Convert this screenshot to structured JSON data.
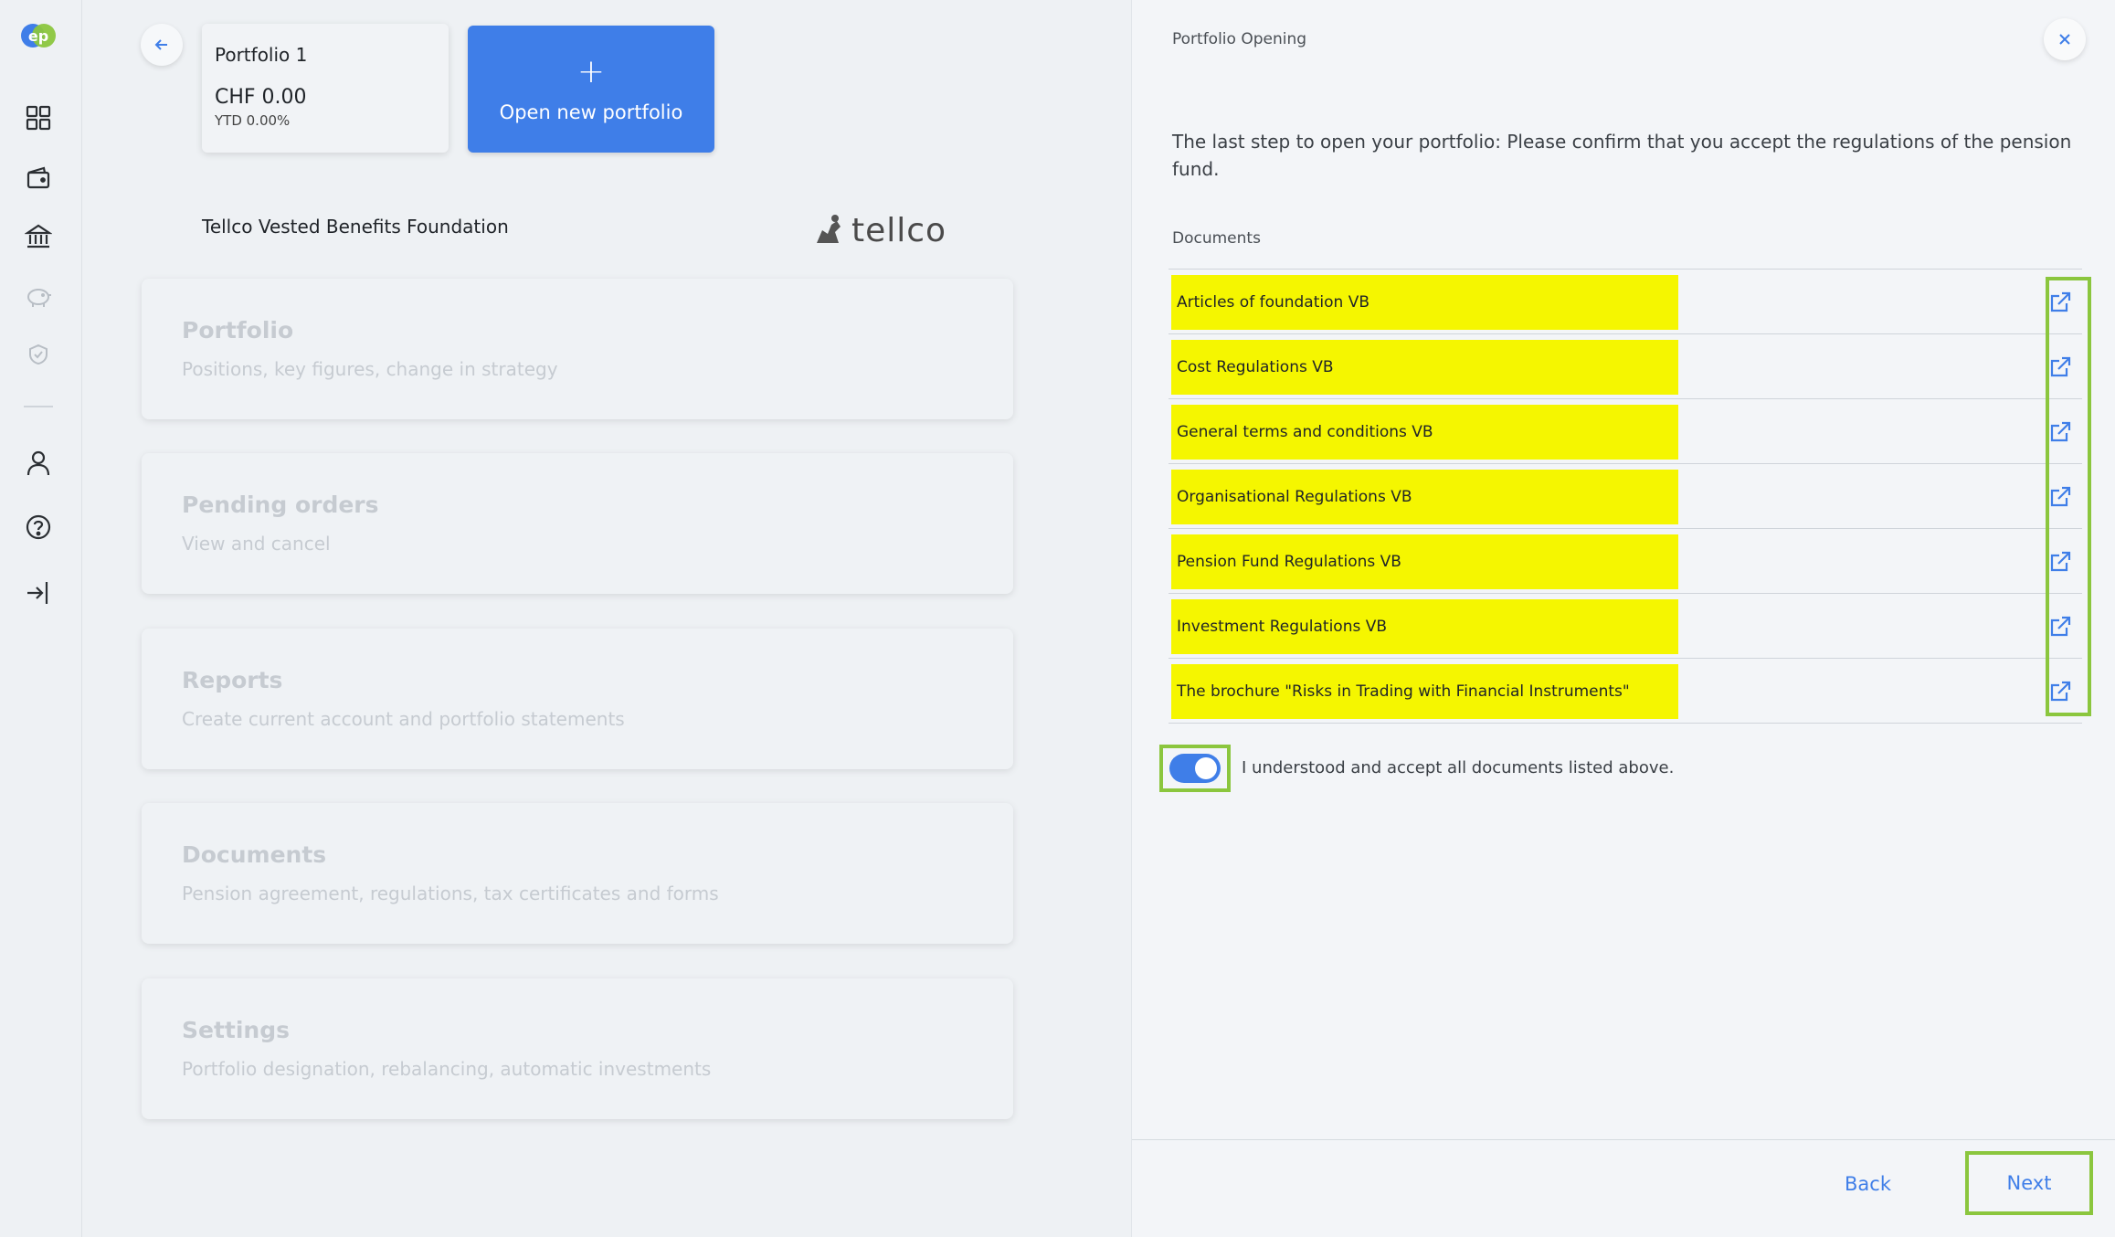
{
  "app": {
    "logo_text": "ep"
  },
  "rail": {
    "icons": [
      "dashboard-icon",
      "wallet-icon",
      "bank-icon",
      "piggy-bank-icon",
      "shield-icon",
      "user-icon",
      "help-icon",
      "logout-icon"
    ]
  },
  "portfolio_card": {
    "name": "Portfolio 1",
    "value": "CHF 0.00",
    "ytd": "YTD 0.00%"
  },
  "open_button": {
    "plus": "+",
    "label": "Open new portfolio"
  },
  "foundation": {
    "name": "Tellco Vested Benefits Foundation",
    "logo_text": "tellco"
  },
  "menu": [
    {
      "title": "Portfolio",
      "subtitle": "Positions, key figures, change in strategy"
    },
    {
      "title": "Pending orders",
      "subtitle": "View and cancel"
    },
    {
      "title": "Reports",
      "subtitle": "Create current account and portfolio statements"
    },
    {
      "title": "Documents",
      "subtitle": "Pension agreement, regulations, tax certificates and forms"
    },
    {
      "title": "Settings",
      "subtitle": "Portfolio designation, rebalancing, automatic investments"
    }
  ],
  "panel": {
    "title": "Portfolio Opening",
    "intro": "The last step to open your portfolio: Please confirm that you accept the regulations of the pension fund.",
    "documents_label": "Documents",
    "documents": [
      "Articles of foundation VB",
      "Cost Regulations VB",
      "General terms and conditions VB",
      "Organisational Regulations VB",
      "Pension Fund Regulations VB",
      "Investment Regulations VB",
      "The brochure \"Risks in Trading with Financial Instruments\""
    ],
    "accept_text": "I understood and accept all documents listed above.",
    "accept_checked": true,
    "back_label": "Back",
    "next_label": "Next"
  },
  "colors": {
    "accent": "#3f7ee8",
    "highlight": "#f5f600",
    "outline": "#8bc63e"
  }
}
